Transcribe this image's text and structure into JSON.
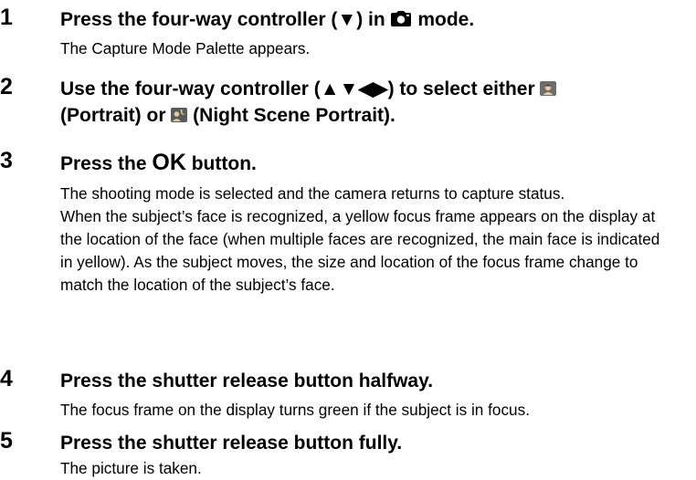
{
  "steps": [
    {
      "number": "1",
      "heading_before": "Press the four-way controller (▼) in ",
      "heading_after": " mode.",
      "body": [
        "The Capture Mode Palette appears."
      ]
    },
    {
      "number": "2",
      "heading_line1_before": "Use the four-way controller (▲▼◀▶) to select either ",
      "heading_line2_a": "(Portrait) or ",
      "heading_line2_b": " (Night Scene Portrait)."
    },
    {
      "number": "3",
      "heading_before": "Press the ",
      "heading_ok": "OK",
      "heading_after": " button.",
      "body": [
        "The shooting mode is selected and the camera returns to capture status.",
        "When the subject’s face is recognized, a yellow focus frame appears on the display at the location of the face (when multiple faces are recognized, the main face is indicated in yellow). As the subject moves, the size and location of the focus frame change to match the location of the subject’s face."
      ]
    },
    {
      "number": "4",
      "heading": "Press the shutter release button halfway.",
      "body": [
        "The focus frame on the display turns green if the subject is in focus."
      ]
    },
    {
      "number": "5",
      "heading": "Press the shutter release button fully.",
      "body": [
        "The picture is taken."
      ]
    }
  ],
  "icons": {
    "capture_mode": "camera-icon",
    "portrait": "portrait-mode-icon",
    "night_scene_portrait": "night-scene-portrait-icon"
  }
}
